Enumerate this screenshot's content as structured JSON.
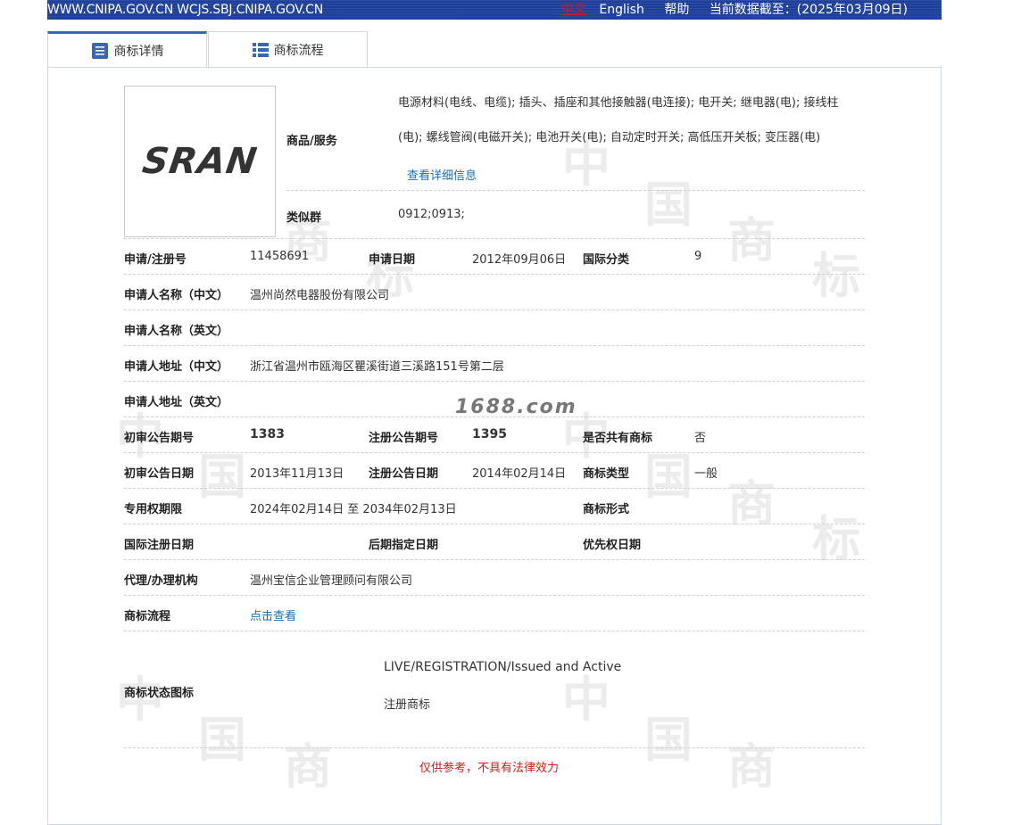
{
  "topbar": {
    "site": "WWW.CNIPA.GOV.CN WCJS.SBJ.CNIPA.GOV.CN",
    "lang_zh": "中文",
    "lang_en": "English",
    "help": "帮助",
    "data_date": "当前数据截至：(2025年03月09日)"
  },
  "tabs": [
    {
      "label": "商标详情",
      "active": true
    },
    {
      "label": "商标流程",
      "active": false
    }
  ],
  "logo": {
    "text": "SRAN"
  },
  "goods": {
    "label": "商品/服务",
    "line1": "电源材料(电线、电缆); 插头、插座和其他接触器(电连接); 电开关; 继电器(电); 接线柱",
    "line2": "(电); 螺线管阀(电磁开关); 电池开关(电); 自动定时开关; 高低压开关板; 变压器(电)",
    "more": "查看详细信息"
  },
  "similar": {
    "label": "类似群",
    "value": "0912;0913;"
  },
  "fields": {
    "reg_no_label": "申请/注册号",
    "reg_no": "11458691",
    "apply_date_label": "申请日期",
    "apply_date": "2012年09月06日",
    "intl_class_label": "国际分类",
    "intl_class": "9",
    "applicant_cn_label": "申请人名称（中文）",
    "applicant_cn": "温州尚然电器股份有限公司",
    "applicant_en_label": "申请人名称（英文）",
    "applicant_en": "",
    "addr_cn_label": "申请人地址（中文）",
    "addr_cn": "浙江省温州市瓯海区瞿溪街道三溪路151号第二层",
    "addr_en_label": "申请人地址（英文）",
    "addr_en": "",
    "prelim_no_label": "初审公告期号",
    "prelim_no": "1383",
    "reg_pub_no_label": "注册公告期号",
    "reg_pub_no": "1395",
    "shared_label": "是否共有商标",
    "shared": "否",
    "prelim_date_label": "初审公告日期",
    "prelim_date": "2013年11月13日",
    "reg_pub_date_label": "注册公告日期",
    "reg_pub_date": "2014年02月14日",
    "type_label": "商标类型",
    "type": "一般",
    "exclusive_label": "专用权期限",
    "exclusive": "2024年02月14日 至 2034年02月13日",
    "form_label": "商标形式",
    "form": "",
    "intl_reg_date_label": "国际注册日期",
    "intl_reg_date": "",
    "later_date_label": "后期指定日期",
    "later_date": "",
    "priority_date_label": "优先权日期",
    "priority_date": "",
    "agent_label": "代理/办理机构",
    "agent": "温州宝信企业管理顾问有限公司",
    "flow_label": "商标流程",
    "flow_link": "点击查看",
    "status_label": "商标状态图标",
    "status_en": "LIVE/REGISTRATION/Issued and Active",
    "status_cn": "注册商标"
  },
  "watermark_site": "1688.com",
  "disclaimer": "仅供参考，不具有法律效力"
}
